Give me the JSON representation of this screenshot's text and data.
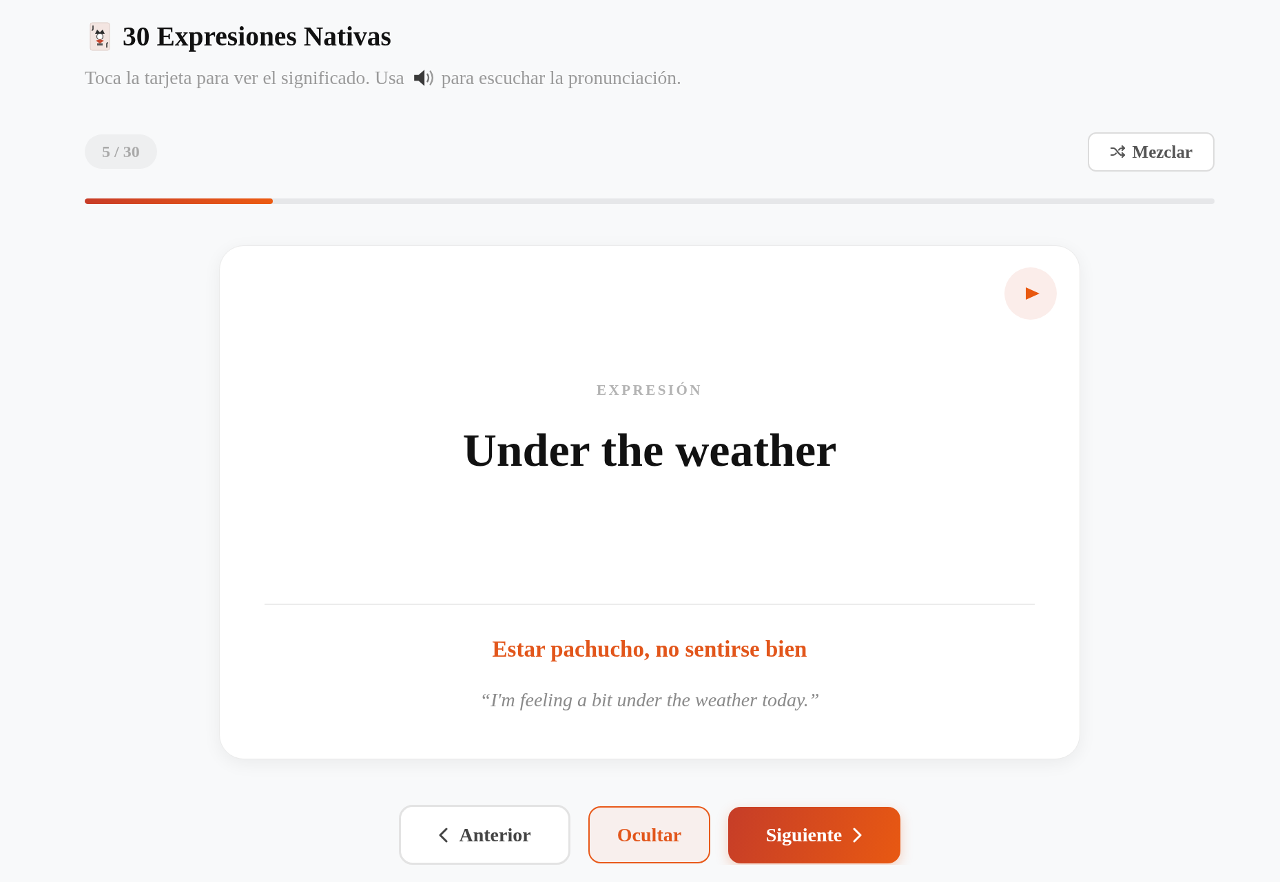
{
  "header": {
    "title": "30 Expresiones Nativas",
    "subtitle_before": "Toca la tarjeta para ver el significado. Usa",
    "subtitle_after": "para escuchar la pronunciación."
  },
  "toolbar": {
    "counter": "5 / 30",
    "shuffle_button": "Mezclar"
  },
  "progress": {
    "level": 0.1667
  },
  "card": {
    "label": "EXPRESIÓN",
    "phrase": "Under the weather",
    "revealed": true,
    "meaning": "Estar pachucho, no sentirse bien",
    "example": "“I'm feeling a bit under the weather today.”"
  },
  "nav_buttons": [
    {
      "kind": "prev",
      "label": "Anterior"
    },
    {
      "kind": "toggle",
      "label": "Ocultar"
    },
    {
      "kind": "next",
      "label": "Siguiente"
    }
  ]
}
